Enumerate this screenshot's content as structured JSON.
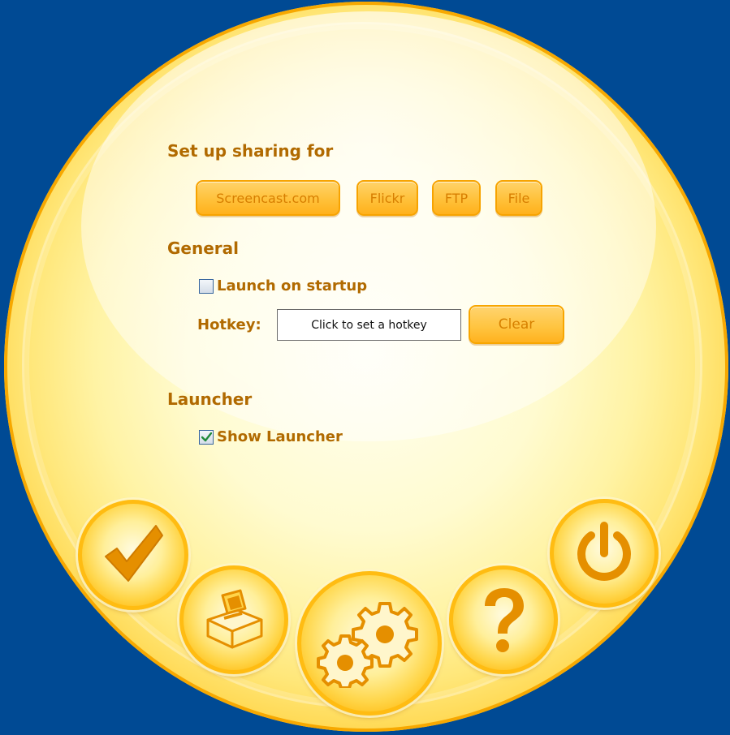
{
  "sharing": {
    "heading": "Set up sharing for",
    "buttons": [
      "Screencast.com",
      "Flickr",
      "FTP",
      "File"
    ]
  },
  "general": {
    "heading": "General",
    "launch_on_startup": {
      "label": "Launch on startup",
      "checked": false
    },
    "hotkey": {
      "label": "Hotkey:",
      "value": "Click to set a hotkey",
      "clear_label": "Clear"
    }
  },
  "launcher": {
    "heading": "Launcher",
    "show_launcher": {
      "label": "Show Launcher",
      "checked": true
    }
  },
  "bottom_buttons": {
    "ok": "checkmark-icon",
    "capture": "ballot-box-icon",
    "settings": "gears-icon",
    "help": "question-mark-icon",
    "power": "power-icon"
  },
  "colors": {
    "background": "#004a94",
    "heading_text": "#b16a00",
    "button_text": "#d77e00",
    "orb_edge": "#ffa500",
    "icon": "#e58f00"
  }
}
